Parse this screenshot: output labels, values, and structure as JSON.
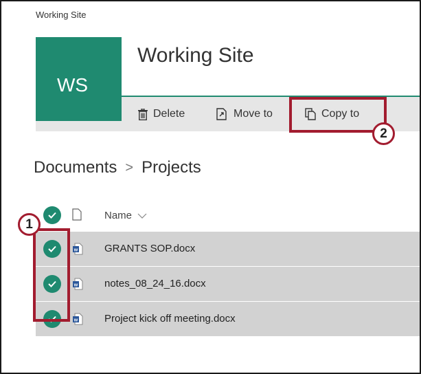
{
  "site": {
    "small_title": "Working Site",
    "title": "Working Site",
    "logo_initials": "WS"
  },
  "commands": {
    "delete_label": "Delete",
    "move_label": "Move to",
    "copy_label": "Copy to"
  },
  "breadcrumb": {
    "root": "Documents",
    "separator": ">",
    "current": "Projects"
  },
  "list": {
    "name_header": "Name",
    "files": [
      "GRANTS SOP.docx",
      "notes_08_24_16.docx",
      "Project kick off meeting.docx"
    ]
  },
  "callouts": {
    "step1": "1",
    "step2": "2"
  },
  "colors": {
    "brand": "#1f8a70",
    "command_bar": "#e6e6e6",
    "selected_row": "#d2d2d2",
    "callout": "#a21c2f",
    "word": "#2b579a"
  },
  "icons": {
    "delete": "trash-icon",
    "move": "move-icon",
    "copy": "copy-icon",
    "check": "checkmark-icon",
    "file": "word-doc-icon"
  }
}
